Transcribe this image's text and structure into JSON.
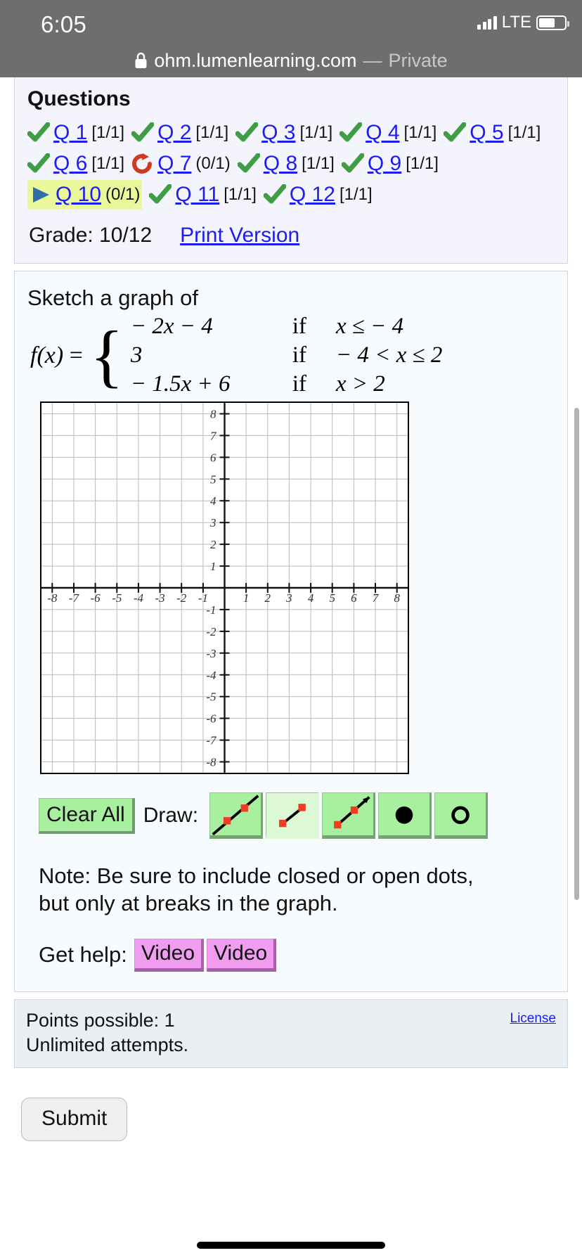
{
  "status_bar": {
    "time": "6:05",
    "carrier": "LTE",
    "signal_icon": "signal-bars-icon",
    "battery_icon": "battery-icon"
  },
  "url_bar": {
    "lock_icon": "lock-icon",
    "url": "ohm.lumenlearning.com",
    "separator": "—",
    "private_label": "Private"
  },
  "questions_panel": {
    "title": "Questions",
    "items": [
      {
        "label": "Q 1",
        "score": "[1/1]",
        "status": "correct",
        "icon": "check-icon",
        "current": false
      },
      {
        "label": "Q 2",
        "score": "[1/1]",
        "status": "correct",
        "icon": "check-icon",
        "current": false
      },
      {
        "label": "Q 3",
        "score": "[1/1]",
        "status": "correct",
        "icon": "check-icon",
        "current": false
      },
      {
        "label": "Q 4",
        "score": "[1/1]",
        "status": "correct",
        "icon": "check-icon",
        "current": false
      },
      {
        "label": "Q 5",
        "score": "[1/1]",
        "status": "correct",
        "icon": "check-icon",
        "current": false
      },
      {
        "label": "Q 6",
        "score": "[1/1]",
        "status": "correct",
        "icon": "check-icon",
        "current": false
      },
      {
        "label": "Q 7",
        "score": "(0/1)",
        "status": "retry",
        "icon": "retry-icon",
        "current": false
      },
      {
        "label": "Q 8",
        "score": "[1/1]",
        "status": "correct",
        "icon": "check-icon",
        "current": false
      },
      {
        "label": "Q 9",
        "score": "[1/1]",
        "status": "correct",
        "icon": "check-icon",
        "current": false
      },
      {
        "label": "Q 10",
        "score": "(0/1)",
        "status": "current",
        "icon": "play-arrow-icon",
        "current": true
      },
      {
        "label": "Q 11",
        "score": "[1/1]",
        "status": "correct",
        "icon": "check-icon",
        "current": false
      },
      {
        "label": "Q 12",
        "score": "[1/1]",
        "status": "correct",
        "icon": "check-icon",
        "current": false
      }
    ],
    "grade_text": "Grade: 10/12",
    "print_version_label": "Print Version"
  },
  "problem": {
    "prompt": "Sketch a graph of",
    "function_label": "f(x)",
    "equals": "=",
    "cases": [
      {
        "expr": "− 2x − 4",
        "if": "if",
        "condition": "x ≤  − 4"
      },
      {
        "expr": "3",
        "if": "if",
        "condition": "− 4 < x ≤ 2"
      },
      {
        "expr": "− 1.5x + 6",
        "if": "if",
        "condition": "x > 2"
      }
    ],
    "note": "Note: Be sure to include closed or open dots, but only at breaks in the graph.",
    "help_label": "Get help:",
    "help_buttons": [
      "Video",
      "Video"
    ]
  },
  "toolbar": {
    "clear_all_label": "Clear All",
    "draw_label": "Draw:",
    "tools": [
      {
        "name": "line-tool",
        "icon": "infinite-line-icon",
        "selected": false
      },
      {
        "name": "segment-tool",
        "icon": "segment-icon",
        "selected": true
      },
      {
        "name": "ray-tool",
        "icon": "ray-icon",
        "selected": false
      },
      {
        "name": "closed-dot-tool",
        "icon": "filled-circle-icon",
        "selected": false
      },
      {
        "name": "open-dot-tool",
        "icon": "hollow-circle-icon",
        "selected": false
      }
    ]
  },
  "footer": {
    "points_possible": "Points possible: 1",
    "attempts": "Unlimited attempts.",
    "license_label": "License",
    "submit_label": "Submit"
  },
  "colors": {
    "link": "#1d1df0",
    "highlight": "#eaf79a",
    "check_green": "#3f9d45",
    "retry_red": "#cf3a21",
    "tool_green": "#a9efa0",
    "video_pink": "#f09df0",
    "panel_bg": "#f4f4fd",
    "problem_bg": "#f7fbfd",
    "footer_bg": "#e9eff2",
    "chrome_gray": "#6e6e6e"
  },
  "chart_data": {
    "type": "line",
    "title": "",
    "xlabel": "",
    "ylabel": "",
    "xlim": [
      -8.5,
      8.5
    ],
    "ylim": [
      -8.5,
      8.5
    ],
    "xticks": [
      -8,
      -7,
      -6,
      -5,
      -4,
      -3,
      -2,
      -1,
      1,
      2,
      3,
      4,
      5,
      6,
      7,
      8
    ],
    "yticks": [
      -8,
      -7,
      -6,
      -5,
      -4,
      -3,
      -2,
      -1,
      1,
      2,
      3,
      4,
      5,
      6,
      7,
      8
    ],
    "grid": true,
    "legend": "none",
    "series": [],
    "note": "Empty student graphing grid; no curve drawn yet."
  }
}
